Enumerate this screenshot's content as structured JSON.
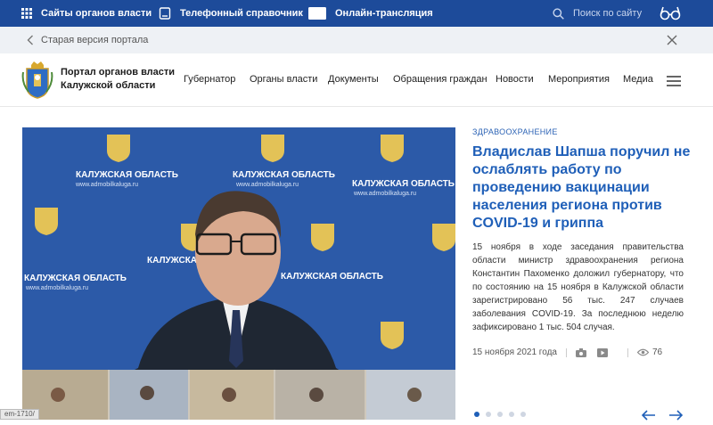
{
  "topbar": {
    "sites_label": "Сайты органов власти",
    "phone_label": "Телефонный справочник",
    "live_label": "Онлайн-трансляция",
    "search_placeholder": "Поиск по сайту"
  },
  "oldbar": {
    "label": "Старая версия портала"
  },
  "header": {
    "brand_line1": "Портал органов власти",
    "brand_line2": "Калужской области",
    "nav": [
      "Губернатор",
      "Органы власти",
      "Документы",
      "Обращения граждан",
      "Новости",
      "Мероприятия",
      "Медиа"
    ]
  },
  "photo": {
    "backdrop_title": "КАЛУЖСКАЯ ОБЛАСТЬ",
    "backdrop_url": "www.admobilkaluga.ru"
  },
  "news": {
    "category": "ЗДРАВООХРАНЕНИЕ",
    "headline": "Владислав Шапша поручил не ослаблять работу по проведению вакцинации населения региона против COVID-19 и гриппа",
    "body": "15 ноября в ходе заседания правительства области министр здравоохранения региона Константин Пахоменко доложил губернатору, что по состоянию на 15 ноября в Калужской области зарегистрировано 56 тыс. 247 случаев заболевания COVID-19. За последнюю неделю зафиксировано 1 тыс. 504 случая.",
    "date": "15 ноября 2021 года",
    "views": "76"
  },
  "slider": {
    "active_index": 0,
    "count": 5
  },
  "statusbar": {
    "text": "em-1710/"
  },
  "colors": {
    "brand_blue": "#1d4b9a",
    "link_blue": "#1f5fb8",
    "photo_blue": "#2b57a8"
  }
}
